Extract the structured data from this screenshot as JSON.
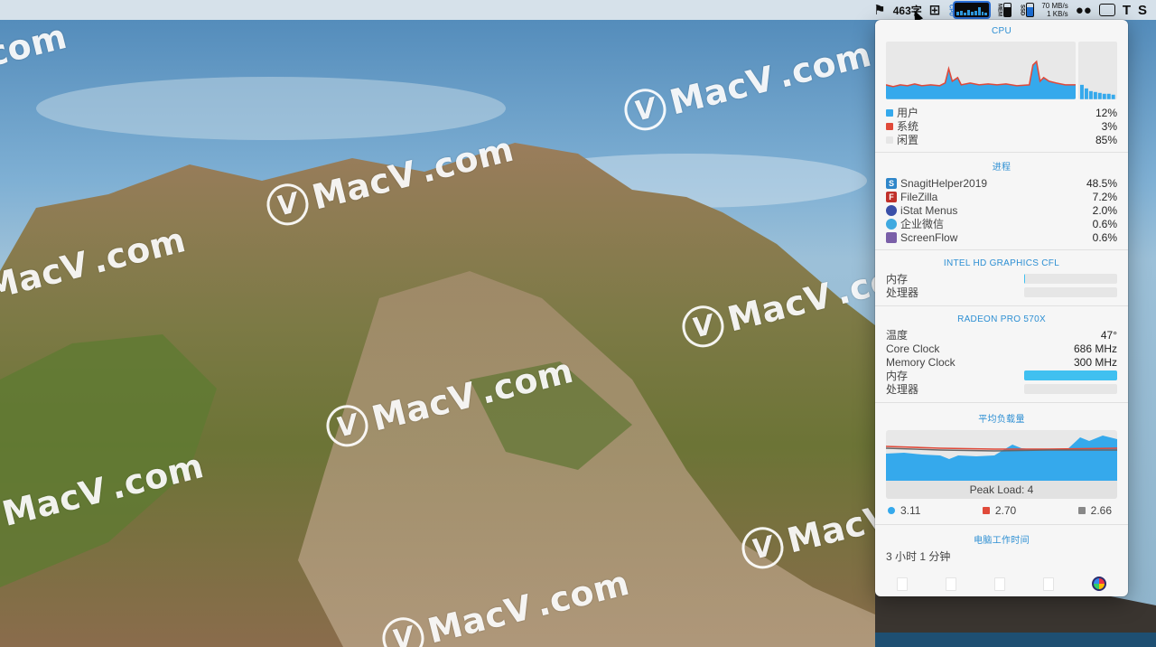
{
  "menubar": {
    "word_count": "463字",
    "cpu_label": "CPU",
    "mem_label": "MEM",
    "ssd_label": "SSD",
    "net_up": "70 MB/s",
    "net_down": "1 KB/s",
    "items": [
      "bookmark-icon",
      "input-method-icon",
      "istat-cpu-icon",
      "istat-memory-icon",
      "istat-ssd-icon",
      "istat-network-icon",
      "wechat-icon",
      "screen-record-icon",
      "text-icon",
      "snagit-icon"
    ]
  },
  "panel": {
    "cpu": {
      "title": "CPU",
      "stats": [
        {
          "label": "用户",
          "value": "12%",
          "color": "#35a9ec"
        },
        {
          "label": "系统",
          "value": "3%",
          "color": "#e04a3a"
        },
        {
          "label": "闲置",
          "value": "85%",
          "color": "#e6e6e6"
        }
      ]
    },
    "processes": {
      "title": "进程",
      "items": [
        {
          "name": "SnagitHelper2019",
          "value": "48.5%",
          "icon": "snagit-icon",
          "color": "#2f86c9"
        },
        {
          "name": "FileZilla",
          "value": "7.2%",
          "icon": "filezilla-icon",
          "color": "#c0302a"
        },
        {
          "name": "iStat Menus",
          "value": "2.0%",
          "icon": "istat-icon",
          "color": "#3a4fa8"
        },
        {
          "name": "企业微信",
          "value": "0.6%",
          "icon": "wecom-icon",
          "color": "#3fa9e0"
        },
        {
          "name": "ScreenFlow",
          "value": "0.6%",
          "icon": "screenflow-icon",
          "color": "#7a5fa8"
        }
      ]
    },
    "intel_gpu": {
      "title": "INTEL HD GRAPHICS CFL",
      "rows": [
        {
          "label": "内存",
          "fill": 0.01
        },
        {
          "label": "处理器",
          "fill": 0.0
        }
      ]
    },
    "radeon_gpu": {
      "title": "RADEON PRO 570X",
      "rows": [
        {
          "label": "温度",
          "value": "47°"
        },
        {
          "label": "Core Clock",
          "value": "686 MHz"
        },
        {
          "label": "Memory Clock",
          "value": "300 MHz"
        }
      ],
      "bars": [
        {
          "label": "内存",
          "fill": 1.0
        },
        {
          "label": "处理器",
          "fill": 0.0
        }
      ]
    },
    "load": {
      "title": "平均负载量",
      "peak_label": "Peak Load: 4",
      "averages": [
        {
          "value": "3.11",
          "color": "#35a9ec"
        },
        {
          "value": "2.70",
          "color": "#e04a3a"
        },
        {
          "value": "2.66",
          "color": "#888888"
        }
      ]
    },
    "uptime": {
      "title": "电脑工作时间",
      "value": "3 小时 1 分钟"
    }
  },
  "watermark": {
    "brand": "MacV",
    "suffix": ".com"
  }
}
